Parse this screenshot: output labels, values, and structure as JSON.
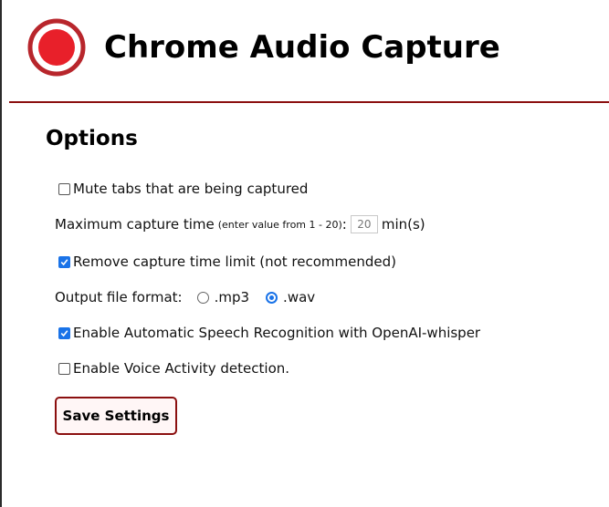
{
  "header": {
    "title": "Chrome Audio Capture",
    "logo_icon": "record-icon",
    "logo_color": "#e8202a",
    "accent_color": "#8b0f0f"
  },
  "options": {
    "section_title": "Options",
    "mute_tabs": {
      "label": "Mute tabs that are being captured",
      "checked": false
    },
    "max_capture_time": {
      "label": "Maximum capture time",
      "note": "(enter value from 1 - 20)",
      "colon": ":",
      "value": "20",
      "unit": "min(s)"
    },
    "remove_limit": {
      "label": "Remove capture time limit (not recommended)",
      "checked": true
    },
    "output_format": {
      "label": "Output file format:",
      "options": [
        {
          "label": ".mp3",
          "selected": false
        },
        {
          "label": ".wav",
          "selected": true
        }
      ]
    },
    "speech_recognition": {
      "label": "Enable Automatic Speech Recognition with OpenAI-whisper",
      "checked": true
    },
    "voice_activity": {
      "label": "Enable Voice Activity detection.",
      "checked": false
    },
    "save_label": "Save Settings",
    "checkbox_color": "#1a73e8"
  }
}
